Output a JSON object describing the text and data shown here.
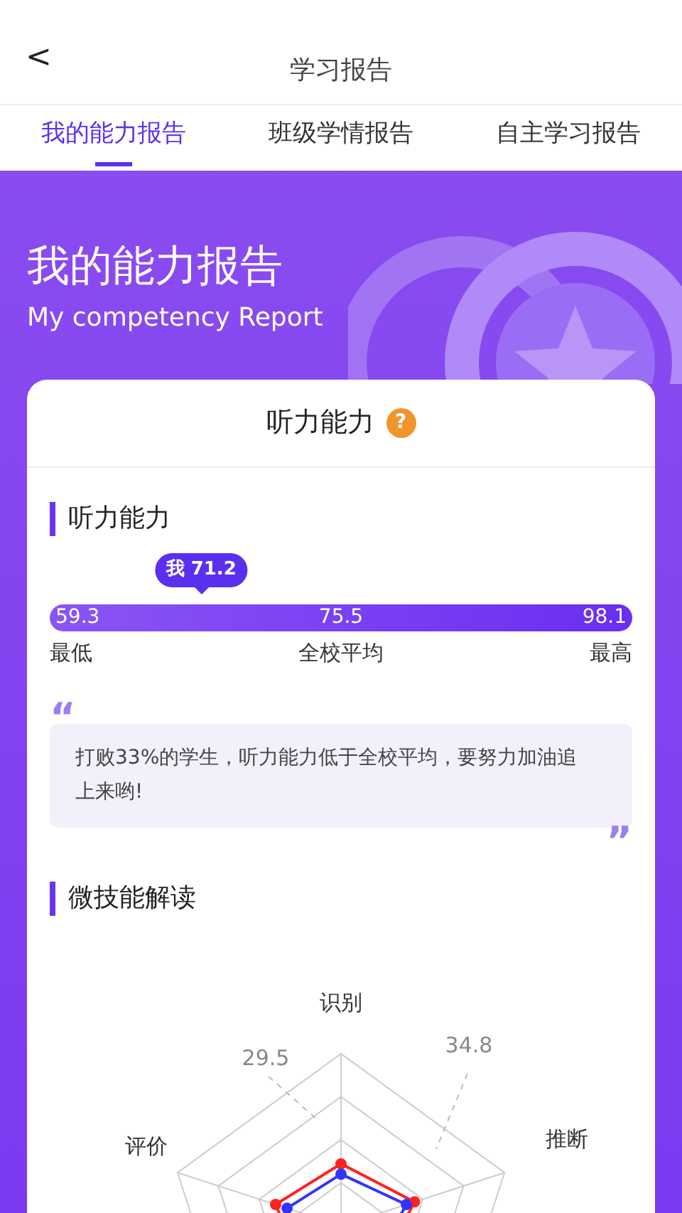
{
  "header": {
    "back": "<",
    "title": "学习报告"
  },
  "tabs": [
    {
      "label": "我的能力报告",
      "selected": true
    },
    {
      "label": "班级学情报告",
      "selected": false
    },
    {
      "label": "自主学习报告",
      "selected": false
    }
  ],
  "banner": {
    "title": "我的能力报告",
    "subtitle": "My competency Report"
  },
  "card": {
    "title": "听力能力",
    "help": "?",
    "section": "听力能力",
    "score": {
      "mine": "我 71.2",
      "min": "59.3",
      "avg": "75.5",
      "max": "98.1",
      "min_label": "最低",
      "avg_label": "全校平均",
      "max_label": "最高"
    },
    "quote": {
      "open": "“",
      "text": "打败33%的学生，听力能力低于全校平均，要努力加油追上来哟!",
      "close": "”"
    },
    "skills_section": "微技能解读",
    "radar": {
      "axes": [
        "识别",
        "推断",
        "评价"
      ],
      "value_labels": [
        "29.5",
        "34.8"
      ]
    }
  }
}
